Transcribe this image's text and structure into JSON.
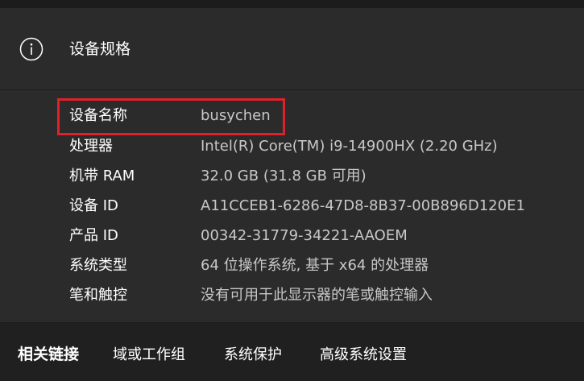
{
  "header": {
    "title": "设备规格",
    "icon": "info-icon"
  },
  "specs": [
    {
      "label": "设备名称",
      "value": "busychen"
    },
    {
      "label": "处理器",
      "value": "Intel(R) Core(TM) i9-14900HX (2.20 GHz)"
    },
    {
      "label": "机带 RAM",
      "value": "32.0 GB (31.8 GB 可用)"
    },
    {
      "label": "设备 ID",
      "value": "A11CCEB1-6286-47D8-8B37-00B896D120E1"
    },
    {
      "label": "产品 ID",
      "value": "00342-31779-34221-AAOEM"
    },
    {
      "label": "系统类型",
      "value": "64 位操作系统, 基于 x64 的处理器"
    },
    {
      "label": "笔和触控",
      "value": "没有可用于此显示器的笔或触控输入"
    }
  ],
  "related": {
    "heading": "相关链接",
    "links": [
      {
        "label": "域或工作组"
      },
      {
        "label": "系统保护"
      },
      {
        "label": "高级系统设置"
      }
    ]
  },
  "colors": {
    "highlight": "#e0202a",
    "card_background": "#2b2b2b",
    "page_background": "#202020"
  }
}
